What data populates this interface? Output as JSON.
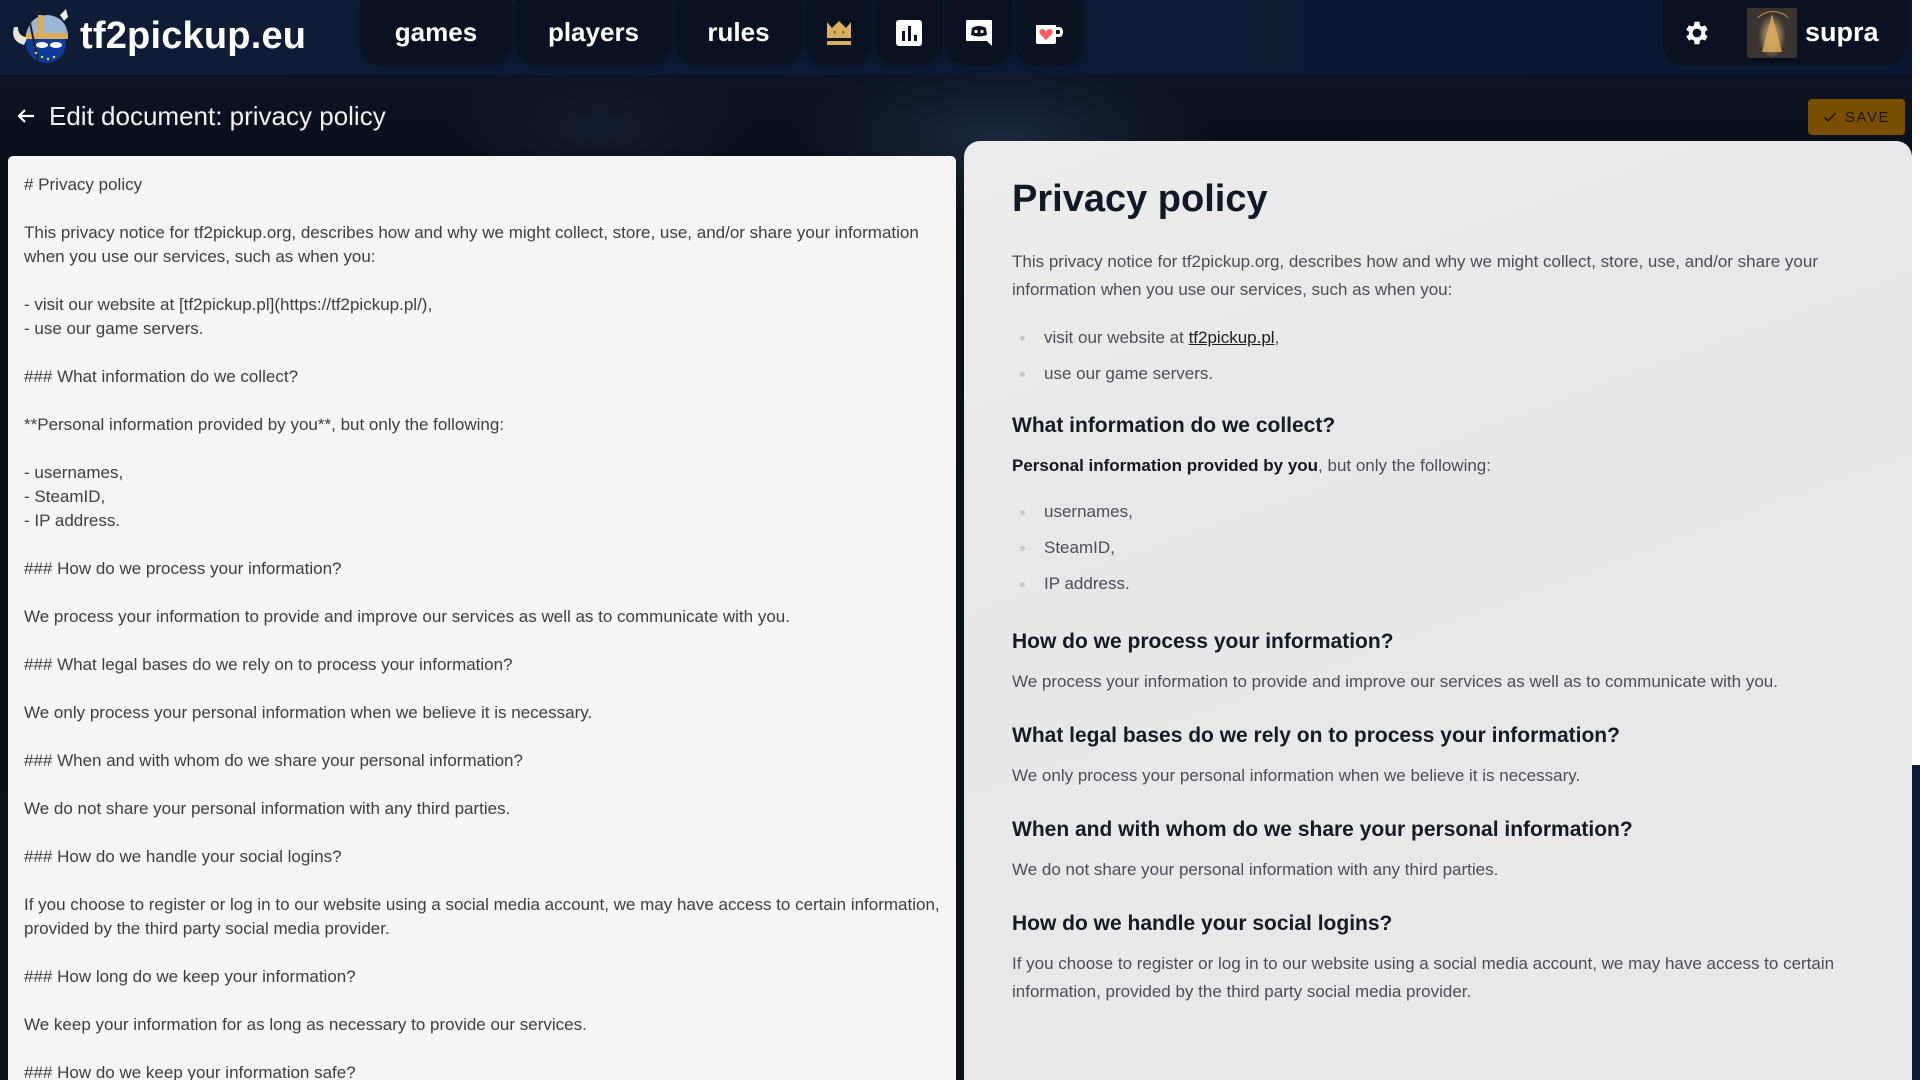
{
  "app": {
    "logo_text": "tf2pickup.eu",
    "username": "supra"
  },
  "nav": {
    "items": [
      {
        "label": "games"
      },
      {
        "label": "players"
      },
      {
        "label": "rules"
      }
    ],
    "icon_items": [
      {
        "icon": "crown-icon",
        "title": "hall of fame"
      },
      {
        "icon": "statistics-icon",
        "title": "statistics"
      },
      {
        "icon": "discord-icon",
        "title": "discord"
      },
      {
        "icon": "ko-fi-icon",
        "title": "ko-fi"
      }
    ]
  },
  "colors": {
    "crown": "#d8b060",
    "save_button": "#7a4e00",
    "kofi_heart": "#ff5a5f"
  },
  "page": {
    "title": "Edit document: privacy policy",
    "save_label": "SAVE"
  },
  "editor": {
    "content": "# Privacy policy\n\nThis privacy notice for tf2pickup.org, describes how and why we might collect, store, use, and/or share your information when you use our services, such as when you:\n\n- visit our website at [tf2pickup.pl](https://tf2pickup.pl/),\n- use our game servers.\n\n### What information do we collect?\n\n**Personal information provided by you**, but only the following:\n\n- usernames,\n- SteamID,\n- IP address.\n\n### How do we process your information?\n\nWe process your information to provide and improve our services as well as to communicate with you.\n\n### What legal bases do we rely on to process your information?\n\nWe only process your personal information when we believe it is necessary.\n\n### When and with whom do we share your personal information?\n\nWe do not share your personal information with any third parties.\n\n### How do we handle your social logins?\n\nIf you choose to register or log in to our website using a social media account, we may have access to certain information, provided by the third party social media provider.\n\n### How long do we keep your information?\n\nWe keep your information for as long as necessary to provide our services.\n\n### How do we keep your information safe?"
  },
  "preview": {
    "title": "Privacy policy",
    "intro": "This privacy notice for tf2pickup.org, describes how and why we might collect, store, use, and/or share your information when you use our services, such as when you:",
    "intro_list": {
      "item1_prefix": "visit our website at ",
      "item1_link": "tf2pickup.pl",
      "item1_suffix": ",",
      "item2": "use our game servers."
    },
    "collect": {
      "heading": "What information do we collect?",
      "strong": "Personal information provided by you",
      "rest": ", but only the following:",
      "items": [
        "usernames,",
        "SteamID,",
        "IP address."
      ]
    },
    "sections": [
      {
        "heading": "How do we process your information?",
        "text": "We process your information to provide and improve our services as well as to communicate with you."
      },
      {
        "heading": "What legal bases do we rely on to process your information?",
        "text": "We only process your personal information when we believe it is necessary."
      },
      {
        "heading": "When and with whom do we share your personal information?",
        "text": "We do not share your personal information with any third parties."
      },
      {
        "heading": "How do we handle your social logins?",
        "text": "If you choose to register or log in to our website using a social media account, we may have access to certain information, provided by the third party social media provider."
      }
    ]
  }
}
